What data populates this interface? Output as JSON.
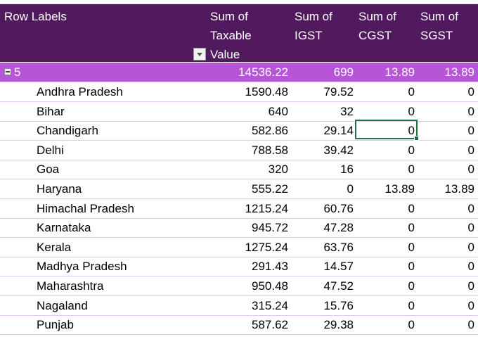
{
  "headers": {
    "row_labels": "Row Labels",
    "taxable": [
      "Sum of",
      "Taxable",
      "Value"
    ],
    "igst": [
      "Sum of",
      "IGST"
    ],
    "cgst": [
      "Sum of",
      "CGST"
    ],
    "sgst": [
      "Sum of",
      "SGST"
    ]
  },
  "group": {
    "label": "5",
    "taxable": "14536.22",
    "igst": "699",
    "cgst": "13.89",
    "sgst": "13.89"
  },
  "rows": [
    {
      "label": "Andhra Pradesh",
      "taxable": "1590.48",
      "igst": "79.52",
      "cgst": "0",
      "sgst": "0"
    },
    {
      "label": "Bihar",
      "taxable": "640",
      "igst": "32",
      "cgst": "0",
      "sgst": "0"
    },
    {
      "label": "Chandigarh",
      "taxable": "582.86",
      "igst": "29.14",
      "cgst": "0",
      "sgst": "0"
    },
    {
      "label": "Delhi",
      "taxable": "788.58",
      "igst": "39.42",
      "cgst": "0",
      "sgst": "0"
    },
    {
      "label": "Goa",
      "taxable": "320",
      "igst": "16",
      "cgst": "0",
      "sgst": "0"
    },
    {
      "label": "Haryana",
      "taxable": "555.22",
      "igst": "0",
      "cgst": "13.89",
      "sgst": "13.89"
    },
    {
      "label": "Himachal Pradesh",
      "taxable": "1215.24",
      "igst": "60.76",
      "cgst": "0",
      "sgst": "0"
    },
    {
      "label": "Karnataka",
      "taxable": "945.72",
      "igst": "47.28",
      "cgst": "0",
      "sgst": "0"
    },
    {
      "label": "Kerala",
      "taxable": "1275.24",
      "igst": "63.76",
      "cgst": "0",
      "sgst": "0"
    },
    {
      "label": "Madhya Pradesh",
      "taxable": "291.43",
      "igst": "14.57",
      "cgst": "0",
      "sgst": "0"
    },
    {
      "label": "Maharashtra",
      "taxable": "950.48",
      "igst": "47.52",
      "cgst": "0",
      "sgst": "0"
    },
    {
      "label": "Nagaland",
      "taxable": "315.24",
      "igst": "15.76",
      "cgst": "0",
      "sgst": "0"
    },
    {
      "label": "Punjab",
      "taxable": "587.62",
      "igst": "29.38",
      "cgst": "0",
      "sgst": "0"
    }
  ],
  "colors": {
    "header": "#521a5e",
    "group": "#b655d6",
    "selection": "#217346"
  }
}
